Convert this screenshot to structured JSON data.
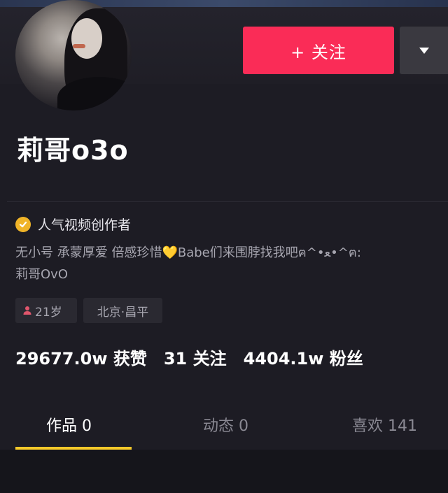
{
  "profile": {
    "name": "莉哥o3o",
    "verified_label": "人气视频创作者",
    "bio_line1": "无小号 承蒙厚爱 倍感珍惜💛Babe们来围脖找我吧ฅ^•ﻌ•^ฅ:",
    "bio_line2": "莉哥OvO",
    "tag_age": "21岁",
    "tag_location": "北京·昌平"
  },
  "actions": {
    "follow_label": "+ 关注"
  },
  "stats": {
    "likes": "29677.0w 获赞",
    "following": "31 关注",
    "fans": "4404.1w 粉丝"
  },
  "tabs": [
    {
      "label": "作品 0"
    },
    {
      "label": "动态 0"
    },
    {
      "label": "喜欢 141"
    }
  ],
  "colors": {
    "accent": "#fa2c57",
    "tab_indicator": "#f5c82a",
    "verified_badge": "#f0b428",
    "background": "#1d1c24"
  },
  "icons": {
    "verified": "check-badge-icon",
    "dropdown": "caret-down-icon",
    "age": "person-icon"
  }
}
